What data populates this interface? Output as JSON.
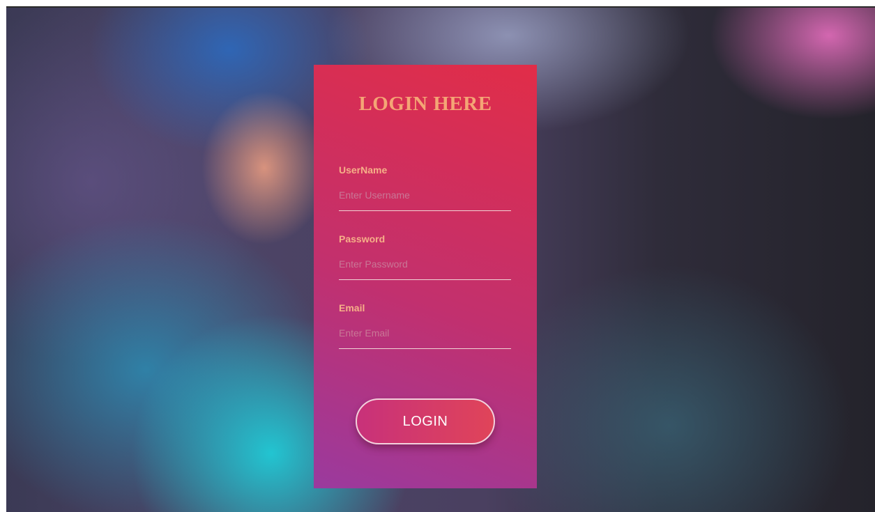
{
  "login": {
    "title": "LOGIN HERE",
    "fields": [
      {
        "label": "UserName",
        "placeholder": "Enter Username"
      },
      {
        "label": "Password",
        "placeholder": "Enter Password"
      },
      {
        "label": "Email",
        "placeholder": "Enter Email"
      }
    ],
    "button_label": "LOGIN"
  },
  "colors": {
    "card_gradient_start": "#9a3a9e",
    "card_gradient_end": "#e12d48",
    "title_color": "#f4a575",
    "label_color": "#f6b088"
  }
}
